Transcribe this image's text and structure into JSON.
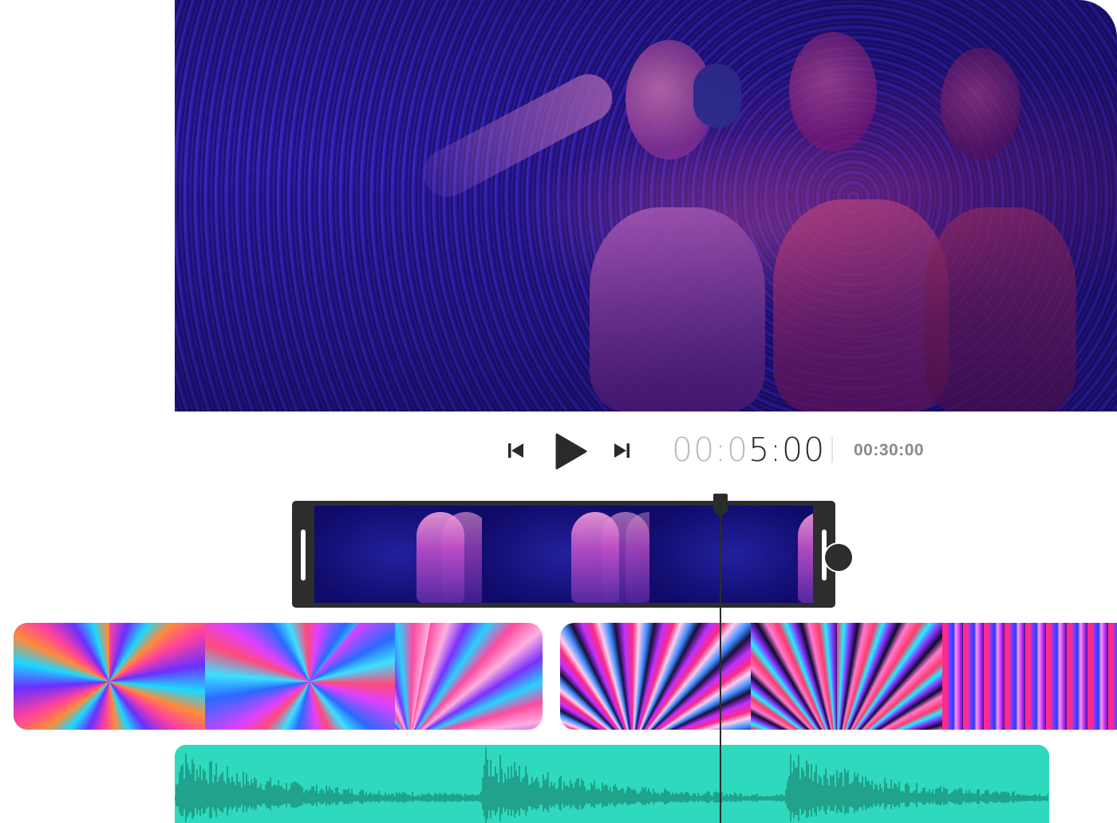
{
  "player": {
    "timecode_elapsed_dim": "00:0",
    "timecode_elapsed_bright": "5:00",
    "duration": "00:30:00"
  },
  "icons": {
    "prev": "skip-previous-icon",
    "play": "play-icon",
    "next": "skip-next-icon"
  },
  "timeline": {
    "selected_clip_thumbnails": 3,
    "tracks": [
      "video-clip",
      "background-clip-swirl",
      "background-clip-burst",
      "audio-track"
    ]
  },
  "colors": {
    "audio_track": "#2ed9bd",
    "waveform": "#1a8a78",
    "clip_frame": "#2d2d2d",
    "timecode_dim": "#b9b9b9",
    "timecode_bright": "#2a2a2a",
    "duration_text": "#8a8a8a"
  }
}
